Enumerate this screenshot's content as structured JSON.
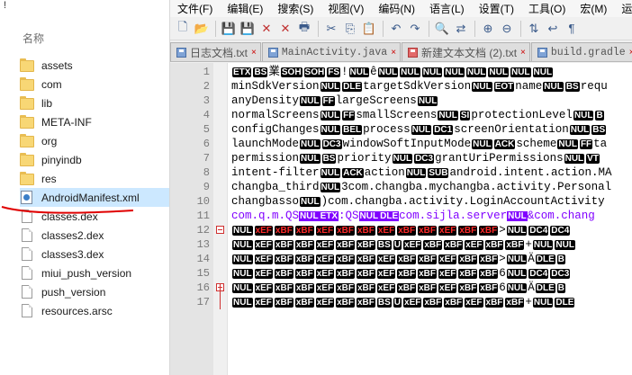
{
  "explorer": {
    "top_mark": "!",
    "column_header": "名称",
    "files": [
      {
        "name": "assets",
        "type": "folder"
      },
      {
        "name": "com",
        "type": "folder"
      },
      {
        "name": "lib",
        "type": "folder"
      },
      {
        "name": "META-INF",
        "type": "folder"
      },
      {
        "name": "org",
        "type": "folder"
      },
      {
        "name": "pinyindb",
        "type": "folder"
      },
      {
        "name": "res",
        "type": "folder"
      },
      {
        "name": "AndroidManifest.xml",
        "type": "xml",
        "selected": true
      },
      {
        "name": "classes.dex",
        "type": "file"
      },
      {
        "name": "classes2.dex",
        "type": "file"
      },
      {
        "name": "classes3.dex",
        "type": "file"
      },
      {
        "name": "miui_push_version",
        "type": "file"
      },
      {
        "name": "push_version",
        "type": "file"
      },
      {
        "name": "resources.arsc",
        "type": "file"
      }
    ]
  },
  "menu": [
    "文件(F)",
    "编辑(E)",
    "搜索(S)",
    "视图(V)",
    "编码(N)",
    "语言(L)",
    "设置(T)",
    "工具(O)",
    "宏(M)",
    "运行(R)"
  ],
  "toolbar_icons": [
    "new-file-icon",
    "open-icon",
    "save-icon",
    "save-all-icon",
    "close-icon",
    "close-all-icon",
    "print-icon",
    "cut-icon",
    "copy-icon",
    "paste-icon",
    "undo-icon",
    "redo-icon",
    "find-icon",
    "replace-icon",
    "zoom-in-icon",
    "zoom-out-icon",
    "sync-icon",
    "wrap-icon",
    "show-all-icon"
  ],
  "tabs": [
    {
      "label": "日志文档.txt",
      "mono": false,
      "active": false,
      "icon_color": "blue"
    },
    {
      "label": "MainActivity.java",
      "mono": true,
      "active": false,
      "icon_color": "blue"
    },
    {
      "label": "新建文本文档 (2).txt",
      "mono": false,
      "active": false,
      "icon_color": "red"
    },
    {
      "label": "build.gradle",
      "mono": true,
      "active": false,
      "icon_color": "blue"
    }
  ],
  "editor": {
    "line_numbers": [
      "1",
      "2",
      "3",
      "4",
      "5",
      "6",
      "7",
      "8",
      "9",
      "10",
      "11",
      "12",
      "13",
      "14",
      "15",
      "16",
      "17"
    ],
    "lines": [
      [
        {
          "t": "ctl",
          "v": "ETX"
        },
        {
          "t": "ctl",
          "v": "BS"
        },
        {
          "t": "txt",
          "v": "業"
        },
        {
          "t": "ctl",
          "v": "SOH"
        },
        {
          "t": "ctl",
          "v": "SOH"
        },
        {
          "t": "ctl",
          "v": "FS"
        },
        {
          "t": "txt",
          "v": "!"
        },
        {
          "t": "ctl",
          "v": "NUL"
        },
        {
          "t": "txt",
          "v": "ê"
        },
        {
          "t": "ctl",
          "v": "NUL"
        },
        {
          "t": "ctl",
          "v": "NUL"
        },
        {
          "t": "ctl",
          "v": "NUL"
        },
        {
          "t": "ctl",
          "v": "NUL"
        },
        {
          "t": "ctl",
          "v": "NUL"
        },
        {
          "t": "ctl",
          "v": "NUL"
        },
        {
          "t": "ctl",
          "v": "NUL"
        },
        {
          "t": "ctl",
          "v": "NUL"
        }
      ],
      [
        {
          "t": "txt",
          "v": "minSdkVersion"
        },
        {
          "t": "ctl",
          "v": "NUL"
        },
        {
          "t": "ctl",
          "v": "DLE"
        },
        {
          "t": "txt",
          "v": "targetSdkVersion"
        },
        {
          "t": "ctl",
          "v": "NUL"
        },
        {
          "t": "ctl",
          "v": "EOT"
        },
        {
          "t": "txt",
          "v": "name"
        },
        {
          "t": "ctl",
          "v": "NUL"
        },
        {
          "t": "ctl",
          "v": "BS"
        },
        {
          "t": "txt",
          "v": "requ"
        }
      ],
      [
        {
          "t": "txt",
          "v": "anyDensity"
        },
        {
          "t": "ctl",
          "v": "NUL"
        },
        {
          "t": "ctl",
          "v": "FF"
        },
        {
          "t": "txt",
          "v": "largeScreens"
        },
        {
          "t": "ctl",
          "v": "NUL"
        }
      ],
      [
        {
          "t": "txt",
          "v": "normalScreens"
        },
        {
          "t": "ctl",
          "v": "NUL"
        },
        {
          "t": "ctl",
          "v": "FF"
        },
        {
          "t": "txt",
          "v": "smallScreens"
        },
        {
          "t": "ctl",
          "v": "NUL"
        },
        {
          "t": "ctl",
          "v": "SI"
        },
        {
          "t": "txt",
          "v": "protectionLevel"
        },
        {
          "t": "ctl",
          "v": "NUL"
        },
        {
          "t": "ctl",
          "v": "B"
        }
      ],
      [
        {
          "t": "txt",
          "v": "configChanges"
        },
        {
          "t": "ctl",
          "v": "NUL"
        },
        {
          "t": "ctl",
          "v": "BEL"
        },
        {
          "t": "txt",
          "v": "process"
        },
        {
          "t": "ctl",
          "v": "NUL"
        },
        {
          "t": "ctl",
          "v": "DC1"
        },
        {
          "t": "txt",
          "v": "screenOrientation"
        },
        {
          "t": "ctl",
          "v": "NUL"
        },
        {
          "t": "ctl",
          "v": "BS"
        }
      ],
      [
        {
          "t": "txt",
          "v": "launchMode"
        },
        {
          "t": "ctl",
          "v": "NUL"
        },
        {
          "t": "ctl",
          "v": "DC3"
        },
        {
          "t": "txt",
          "v": "windowSoftInputMode"
        },
        {
          "t": "ctl",
          "v": "NUL"
        },
        {
          "t": "ctl",
          "v": "ACK"
        },
        {
          "t": "txt",
          "v": "scheme"
        },
        {
          "t": "ctl",
          "v": "NUL"
        },
        {
          "t": "ctl",
          "v": "FF"
        },
        {
          "t": "txt",
          "v": "ta"
        }
      ],
      [
        {
          "t": "txt",
          "v": "permission"
        },
        {
          "t": "ctl",
          "v": "NUL"
        },
        {
          "t": "ctl",
          "v": "BS"
        },
        {
          "t": "txt",
          "v": "priority"
        },
        {
          "t": "ctl",
          "v": "NUL"
        },
        {
          "t": "ctl",
          "v": "DC3"
        },
        {
          "t": "txt",
          "v": "grantUriPermissions"
        },
        {
          "t": "ctl",
          "v": "NUL"
        },
        {
          "t": "ctl",
          "v": "VT"
        }
      ],
      [
        {
          "t": "txt",
          "v": "intent-filter"
        },
        {
          "t": "ctl",
          "v": "NUL"
        },
        {
          "t": "ctl",
          "v": "ACK"
        },
        {
          "t": "txt",
          "v": "action"
        },
        {
          "t": "ctl",
          "v": "NUL"
        },
        {
          "t": "ctl",
          "v": "SUB"
        },
        {
          "t": "txt",
          "v": "android.intent.action.MA"
        }
      ],
      [
        {
          "t": "txt",
          "v": "changba_third"
        },
        {
          "t": "ctl",
          "v": "NUL"
        },
        {
          "t": "txt",
          "v": "3com.changba.mychangba.activity.Personal"
        }
      ],
      [
        {
          "t": "txt",
          "v": "changbasso"
        },
        {
          "t": "ctl",
          "v": "NUL"
        },
        {
          "t": "txt",
          "v": ")com.changba.activity.LoginAccountActivity"
        }
      ],
      [
        {
          "t": "blue",
          "v": "com.q.m.QS"
        },
        {
          "t": "purple",
          "v": "NUL"
        },
        {
          "t": "purple",
          "v": "ETX"
        },
        {
          "t": "blue",
          "v": ":QS"
        },
        {
          "t": "purple",
          "v": "NUL"
        },
        {
          "t": "purple",
          "v": "DLE"
        },
        {
          "t": "blue",
          "v": "com.sijla.server"
        },
        {
          "t": "purple",
          "v": "NUL"
        },
        {
          "t": "blue",
          "v": "&com.chang"
        }
      ],
      [
        {
          "t": "ctl",
          "v": "NUL"
        },
        {
          "t": "red",
          "v": "xEF"
        },
        {
          "t": "red",
          "v": "xBF"
        },
        {
          "t": "red",
          "v": "xBF"
        },
        {
          "t": "red",
          "v": "xEF"
        },
        {
          "t": "red",
          "v": "xBF"
        },
        {
          "t": "red",
          "v": "xBF"
        },
        {
          "t": "red",
          "v": "xEF"
        },
        {
          "t": "red",
          "v": "xBF"
        },
        {
          "t": "red",
          "v": "xBF"
        },
        {
          "t": "red",
          "v": "xEF"
        },
        {
          "t": "red",
          "v": "xBF"
        },
        {
          "t": "red",
          "v": "xBF"
        },
        {
          "t": "txt",
          "v": ">"
        },
        {
          "t": "ctl",
          "v": "NUL"
        },
        {
          "t": "ctl",
          "v": "DC4"
        },
        {
          "t": "ctl",
          "v": "DC4"
        }
      ],
      [
        {
          "t": "ctl",
          "v": "NUL"
        },
        {
          "t": "ctl",
          "v": "xEF"
        },
        {
          "t": "ctl",
          "v": "xBF"
        },
        {
          "t": "ctl",
          "v": "xBF"
        },
        {
          "t": "ctl",
          "v": "xEF"
        },
        {
          "t": "ctl",
          "v": "xBF"
        },
        {
          "t": "ctl",
          "v": "xBF"
        },
        {
          "t": "ctl",
          "v": "BS"
        },
        {
          "t": "ctl",
          "v": "U"
        },
        {
          "t": "ctl",
          "v": "xEF"
        },
        {
          "t": "ctl",
          "v": "xBF"
        },
        {
          "t": "ctl",
          "v": "xBF"
        },
        {
          "t": "ctl",
          "v": "xEF"
        },
        {
          "t": "ctl",
          "v": "xBF"
        },
        {
          "t": "ctl",
          "v": "xBF"
        },
        {
          "t": "txt",
          "v": "+"
        },
        {
          "t": "ctl",
          "v": "NUL"
        },
        {
          "t": "ctl",
          "v": "NUL"
        }
      ],
      [
        {
          "t": "ctl",
          "v": "NUL"
        },
        {
          "t": "ctl",
          "v": "xEF"
        },
        {
          "t": "ctl",
          "v": "xBF"
        },
        {
          "t": "ctl",
          "v": "xBF"
        },
        {
          "t": "ctl",
          "v": "xEF"
        },
        {
          "t": "ctl",
          "v": "xBF"
        },
        {
          "t": "ctl",
          "v": "xBF"
        },
        {
          "t": "ctl",
          "v": "xEF"
        },
        {
          "t": "ctl",
          "v": "xBF"
        },
        {
          "t": "ctl",
          "v": "xBF"
        },
        {
          "t": "ctl",
          "v": "xEF"
        },
        {
          "t": "ctl",
          "v": "xBF"
        },
        {
          "t": "ctl",
          "v": "xBF"
        },
        {
          "t": "txt",
          "v": ">"
        },
        {
          "t": "ctl",
          "v": "NUL"
        },
        {
          "t": "txt",
          "v": "Ä"
        },
        {
          "t": "ctl",
          "v": "DLE"
        },
        {
          "t": "ctl",
          "v": "B"
        }
      ],
      [
        {
          "t": "ctl",
          "v": "NUL"
        },
        {
          "t": "ctl",
          "v": "xEF"
        },
        {
          "t": "ctl",
          "v": "xBF"
        },
        {
          "t": "ctl",
          "v": "xBF"
        },
        {
          "t": "ctl",
          "v": "xEF"
        },
        {
          "t": "ctl",
          "v": "xBF"
        },
        {
          "t": "ctl",
          "v": "xBF"
        },
        {
          "t": "ctl",
          "v": "xEF"
        },
        {
          "t": "ctl",
          "v": "xBF"
        },
        {
          "t": "ctl",
          "v": "xBF"
        },
        {
          "t": "ctl",
          "v": "xEF"
        },
        {
          "t": "ctl",
          "v": "xBF"
        },
        {
          "t": "ctl",
          "v": "xBF"
        },
        {
          "t": "txt",
          "v": "6"
        },
        {
          "t": "ctl",
          "v": "NUL"
        },
        {
          "t": "ctl",
          "v": "DC4"
        },
        {
          "t": "ctl",
          "v": "DC3"
        }
      ],
      [
        {
          "t": "ctl",
          "v": "NUL"
        },
        {
          "t": "ctl",
          "v": "xEF"
        },
        {
          "t": "ctl",
          "v": "xBF"
        },
        {
          "t": "ctl",
          "v": "xBF"
        },
        {
          "t": "ctl",
          "v": "xEF"
        },
        {
          "t": "ctl",
          "v": "xBF"
        },
        {
          "t": "ctl",
          "v": "xBF"
        },
        {
          "t": "ctl",
          "v": "xEF"
        },
        {
          "t": "ctl",
          "v": "xBF"
        },
        {
          "t": "ctl",
          "v": "xBF"
        },
        {
          "t": "ctl",
          "v": "xEF"
        },
        {
          "t": "ctl",
          "v": "xBF"
        },
        {
          "t": "ctl",
          "v": "xBF"
        },
        {
          "t": "txt",
          "v": "6"
        },
        {
          "t": "ctl",
          "v": "NUL"
        },
        {
          "t": "txt",
          "v": "Ä"
        },
        {
          "t": "ctl",
          "v": "DLE"
        },
        {
          "t": "ctl",
          "v": "B"
        }
      ],
      [
        {
          "t": "ctl",
          "v": "NUL"
        },
        {
          "t": "ctl",
          "v": "xEF"
        },
        {
          "t": "ctl",
          "v": "xBF"
        },
        {
          "t": "ctl",
          "v": "xBF"
        },
        {
          "t": "ctl",
          "v": "xEF"
        },
        {
          "t": "ctl",
          "v": "xBF"
        },
        {
          "t": "ctl",
          "v": "xBF"
        },
        {
          "t": "ctl",
          "v": "BS"
        },
        {
          "t": "ctl",
          "v": "U"
        },
        {
          "t": "ctl",
          "v": "xEF"
        },
        {
          "t": "ctl",
          "v": "xBF"
        },
        {
          "t": "ctl",
          "v": "xBF"
        },
        {
          "t": "ctl",
          "v": "xEF"
        },
        {
          "t": "ctl",
          "v": "xBF"
        },
        {
          "t": "ctl",
          "v": "xBF"
        },
        {
          "t": "txt",
          "v": "+"
        },
        {
          "t": "ctl",
          "v": "NUL"
        },
        {
          "t": "ctl",
          "v": "DLE"
        }
      ]
    ]
  }
}
